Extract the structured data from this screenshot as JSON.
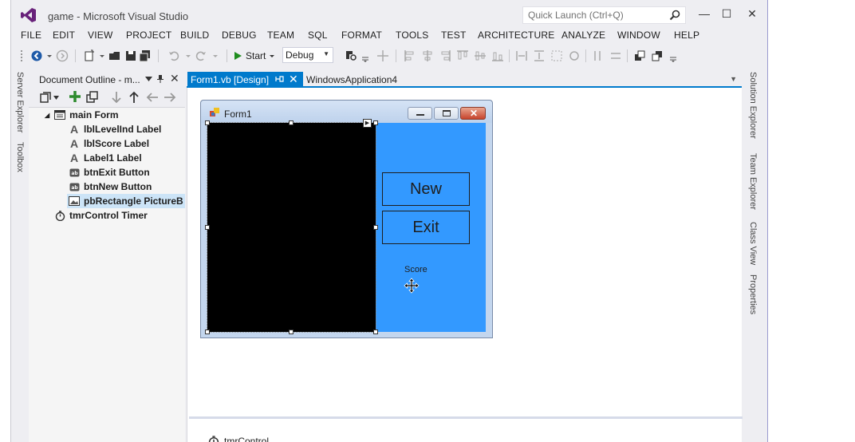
{
  "window": {
    "title": "game - Microsoft Visual Studio",
    "quick_launch_placeholder": "Quick Launch (Ctrl+Q)",
    "minimize_glyph": "—",
    "maximize_glyph": "☐",
    "close_glyph": "✕"
  },
  "menu": [
    "FILE",
    "EDIT",
    "VIEW",
    "PROJECT",
    "BUILD",
    "DEBUG",
    "TEAM",
    "SQL",
    "FORMAT",
    "TOOLS",
    "TEST",
    "ARCHITECTURE",
    "ANALYZE",
    "WINDOW",
    "HELP"
  ],
  "toolbar": {
    "start_label": "Start",
    "configuration": "Debug"
  },
  "left_tabs": [
    "Server Explorer",
    "Toolbox"
  ],
  "right_tabs": [
    "Solution Explorer",
    "Team Explorer",
    "Class View",
    "Properties"
  ],
  "outline": {
    "title": "Document Outline - m...",
    "items": [
      {
        "label": "main  Form",
        "icon": "form-icon"
      },
      {
        "label": "lblLevelInd  Label",
        "icon": "label-icon"
      },
      {
        "label": "lblScore  Label",
        "icon": "label-icon"
      },
      {
        "label": "Label1  Label",
        "icon": "label-icon"
      },
      {
        "label": "btnExit  Button",
        "icon": "button-icon"
      },
      {
        "label": "btnNew  Button",
        "icon": "button-icon"
      },
      {
        "label": "pbRectangle  PictureB",
        "icon": "picturebox-icon"
      },
      {
        "label": "tmrControl  Timer",
        "icon": "timer-icon"
      }
    ]
  },
  "tabs": {
    "active": "Form1.vb [Design]",
    "inactive": "WindowsApplication4"
  },
  "form": {
    "title": "Form1",
    "new_button": "New",
    "exit_button": "Exit",
    "score_label": "Score"
  },
  "tray": {
    "item": "tmrControl"
  },
  "colors": {
    "accent": "#007acc",
    "form_back": "#3399ff",
    "picture_back": "#000000"
  }
}
